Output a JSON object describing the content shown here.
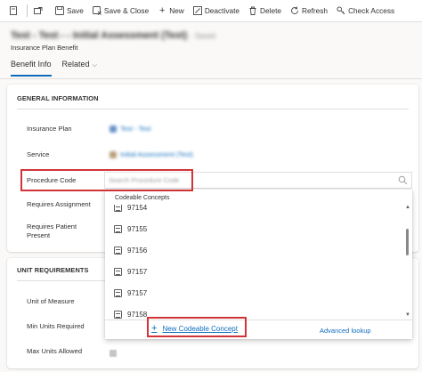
{
  "toolbar": {
    "save": "Save",
    "save_close": "Save & Close",
    "new": "New",
    "deactivate": "Deactivate",
    "delete": "Delete",
    "refresh": "Refresh",
    "check_access": "Check Access"
  },
  "header": {
    "record_title": "Test - Test - - Initial Assessment (Test)",
    "saved_status": "- Saved",
    "entity_name": "Insurance Plan Benefit"
  },
  "tabs": [
    {
      "label": "Benefit Info"
    },
    {
      "label": "Related"
    }
  ],
  "general": {
    "heading": "GENERAL INFORMATION",
    "insurance_plan_label": "Insurance Plan",
    "insurance_plan_value": "Test - Test",
    "service_label": "Service",
    "service_value": "Initial Assessment (Test)",
    "procedure_code_label": "Procedure Code",
    "procedure_code_placeholder": "Search Procedure Code",
    "requires_assignment_label": "Requires Assignment",
    "requires_patient_present_label": "Requires Patient Present"
  },
  "dropdown": {
    "heading": "Codeable Concepts",
    "items": [
      "97154",
      "97155",
      "97156",
      "97157",
      "97157",
      "97158"
    ],
    "new_label": "New Codeable Concept",
    "advanced_lookup": "Advanced lookup"
  },
  "unit": {
    "heading": "UNIT REQUIREMENTS",
    "unit_of_measure_label": "Unit of Measure",
    "min_units_label": "Min Units Required",
    "max_units_label": "Max Units Allowed"
  },
  "colors": {
    "accent": "#0f6cbd",
    "highlight": "#d13438"
  }
}
